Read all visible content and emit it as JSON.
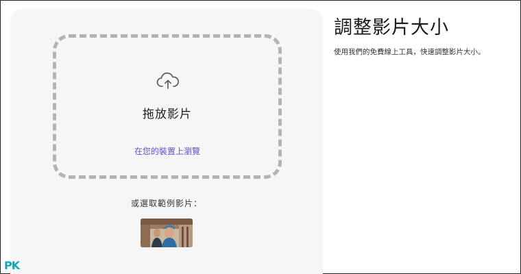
{
  "page": {
    "title": "調整影片大小",
    "description": "使用我們的免費線上工具，快速調整影片大小。"
  },
  "upload": {
    "drop_title": "拖放影片",
    "browse_link": "在您的裝置上瀏覽",
    "sample_label": "或選取範例影片："
  },
  "icons": {
    "upload": "cloud-upload-icon"
  },
  "colors": {
    "panel_bg": "#f6f6f6",
    "dashed_border": "#b3b3b3",
    "link": "#5a55c9",
    "watermark": "#1aa3b8"
  },
  "watermark": {
    "logo_text": "PK"
  }
}
